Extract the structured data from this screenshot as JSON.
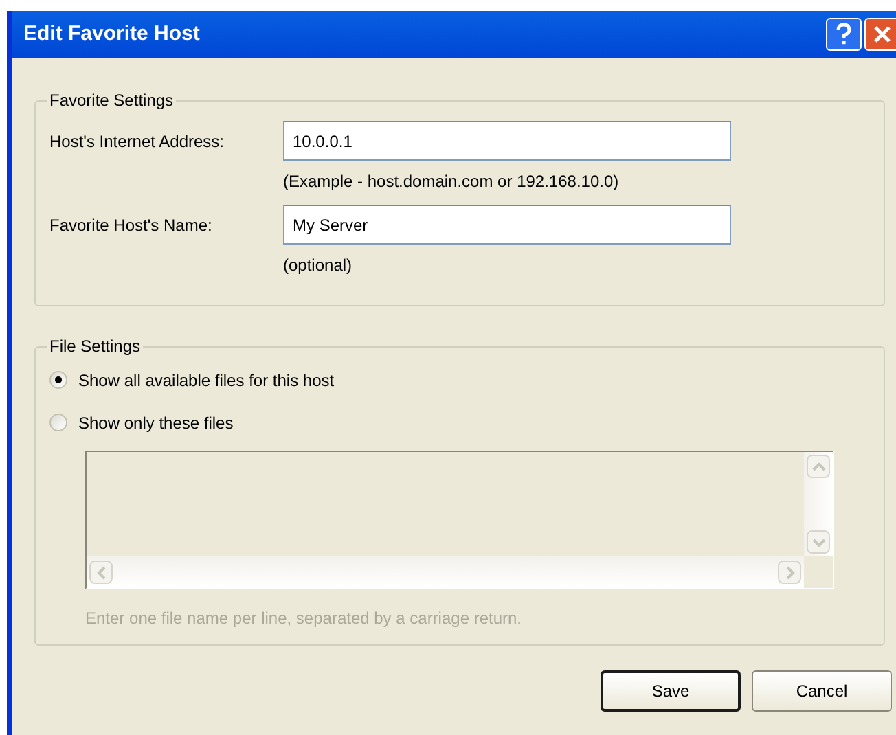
{
  "window": {
    "title": "Edit Favorite Host"
  },
  "favorite_settings": {
    "legend": "Favorite Settings",
    "fields": [
      {
        "label": "Host's Internet Address:",
        "value": "10.0.0.1",
        "note": "(Example - host.domain.com or 192.168.10.0)"
      },
      {
        "label": "Favorite Host's Name:",
        "value": "My Server",
        "note": "(optional)"
      }
    ]
  },
  "file_settings": {
    "legend": "File Settings",
    "options": [
      {
        "label": "Show all available files for this host",
        "selected": true
      },
      {
        "label": "Show only these files",
        "selected": false
      }
    ],
    "file_list": {
      "disabled": true,
      "hint": "Enter one file name per line, separated by a carriage return."
    }
  },
  "buttons": [
    {
      "label": "Save",
      "default": true
    },
    {
      "label": "Cancel",
      "default": false
    }
  ]
}
